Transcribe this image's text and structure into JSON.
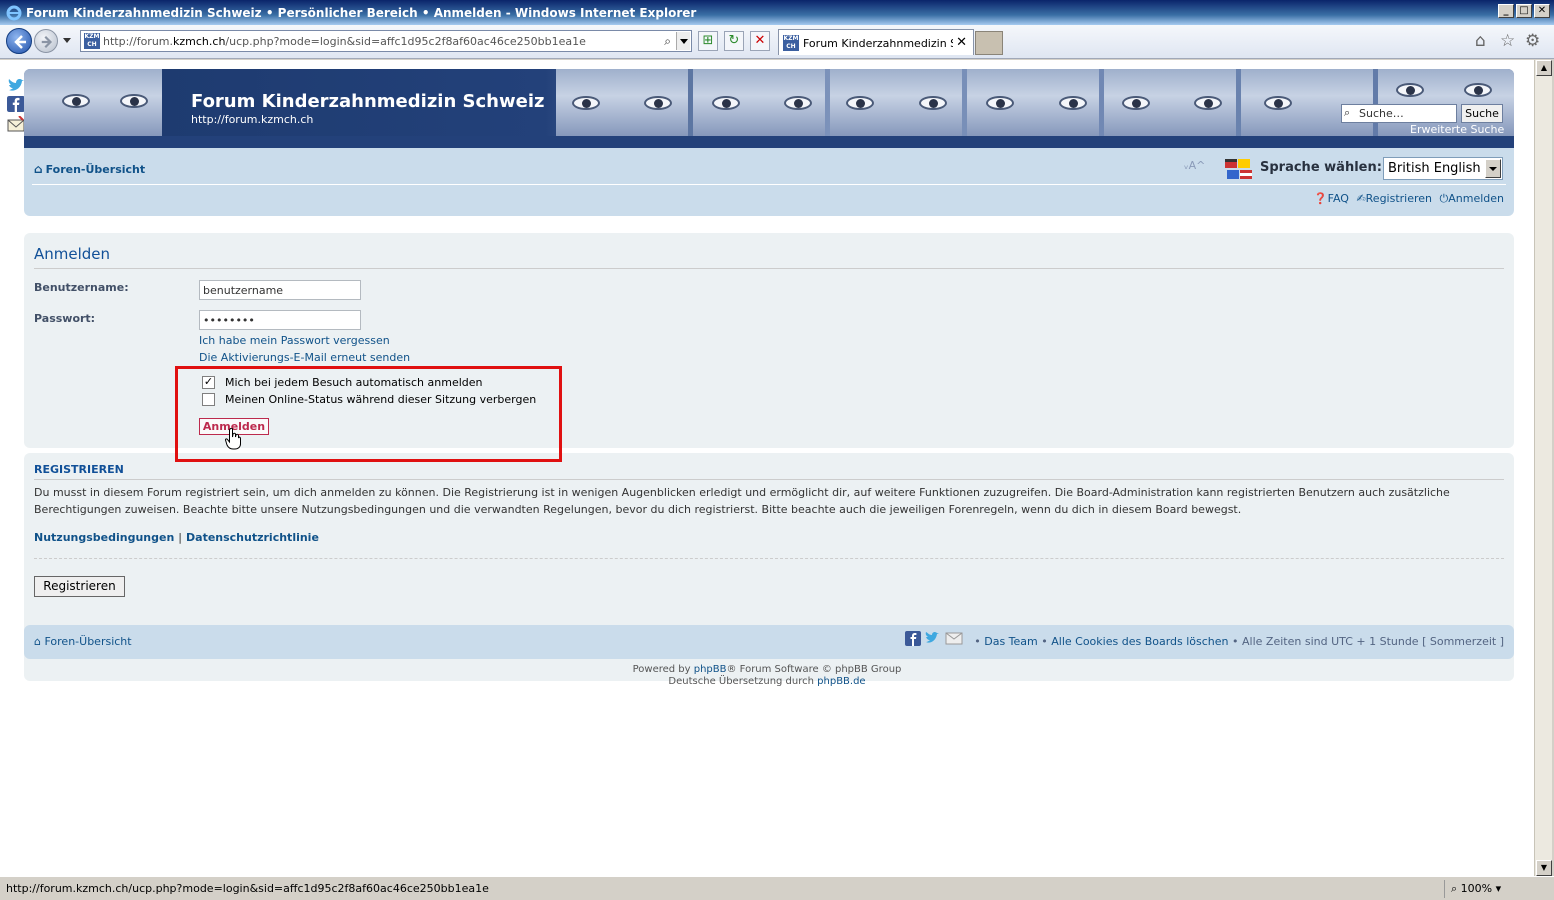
{
  "window": {
    "title": "Forum Kinderzahnmedizin Schweiz • Persönlicher Bereich • Anmelden - Windows Internet Explorer",
    "buttons": [
      "_",
      "□",
      "✕"
    ]
  },
  "browser": {
    "address_prefix": "http://forum.",
    "address_host": "kzmch.ch",
    "address_rest": "/ucp.php?mode=login&sid=affc1d95c2f8af60ac46ce250bb1ea1e",
    "favicon_text": "KZM CH",
    "tab_title": "Forum Kinderzahnmedizin Sc...",
    "tab_close": "✕"
  },
  "header": {
    "site_title": "Forum Kinderzahnmedizin Schweiz",
    "site_url": "http://forum.kzmch.ch",
    "search_placeholder": "Suche…",
    "search_button": "Suche",
    "advanced_search": "Erweiterte Suche"
  },
  "nav": {
    "breadcrumb": "Foren-Übersicht",
    "font_size_toggle": "ᵥA^",
    "language_label": "Sprache wählen:",
    "language_selected": "British English",
    "quicklinks": {
      "faq": "FAQ",
      "register": "Registrieren",
      "login": "Anmelden"
    }
  },
  "login": {
    "heading": "Anmelden",
    "username_label": "Benutzername:",
    "username_value": "benutzername",
    "password_label": "Passwort:",
    "password_value": "••••••••",
    "forgot_password": "Ich habe mein Passwort vergessen",
    "resend_activation": "Die Aktivierungs-E-Mail erneut senden",
    "autologin_label": "Mich bei jedem Besuch automatisch anmelden",
    "autologin_checked": true,
    "hide_online_label": "Meinen Online-Status während dieser Sitzung verbergen",
    "hide_online_checked": false,
    "submit_label": "Anmelden"
  },
  "register": {
    "heading": "REGISTRIEREN",
    "text": "Du musst in diesem Forum registriert sein, um dich anmelden zu können. Die Registrierung ist in wenigen Augenblicken erledigt und ermöglicht dir, auf weitere Funktionen zuzugreifen. Die Board-Administration kann registrierten Benutzern auch zusätzliche Berechtigungen zuweisen. Beachte bitte unsere Nutzungsbedingungen und die verwandten Regelungen, bevor du dich registrierst. Bitte beachte auch die jeweiligen Forenregeln, wenn du dich in diesem Board bewegst.",
    "terms_link": "Nutzungsbedingungen",
    "separator": "|",
    "privacy_link": "Datenschutzrichtlinie",
    "button": "Registrieren"
  },
  "footer": {
    "breadcrumb": "Foren-Übersicht",
    "bullet": "•",
    "team": "Das Team",
    "delete_cookies": "Alle Cookies des Boards löschen",
    "timezone": "Alle Zeiten sind UTC + 1 Stunde [ Sommerzeit ]",
    "powered_prefix": "Powered by ",
    "powered_link": "phpBB",
    "powered_suffix": "® Forum Software © phpBB Group",
    "translation_prefix": "Deutsche Übersetzung durch ",
    "translation_link": "phpBB.de"
  },
  "statusbar": {
    "url": "http://forum.kzmch.ch/ucp.php?mode=login&sid=affc1d95c2f8af60ac46ce250bb1ea1e",
    "zoom": "100%"
  },
  "colors": {
    "link": "#105289",
    "highlight_box": "#e01010",
    "login_button": "#bc2a4d",
    "panel_bg": "#ecf1f3",
    "nav_bg": "#cadceb"
  }
}
